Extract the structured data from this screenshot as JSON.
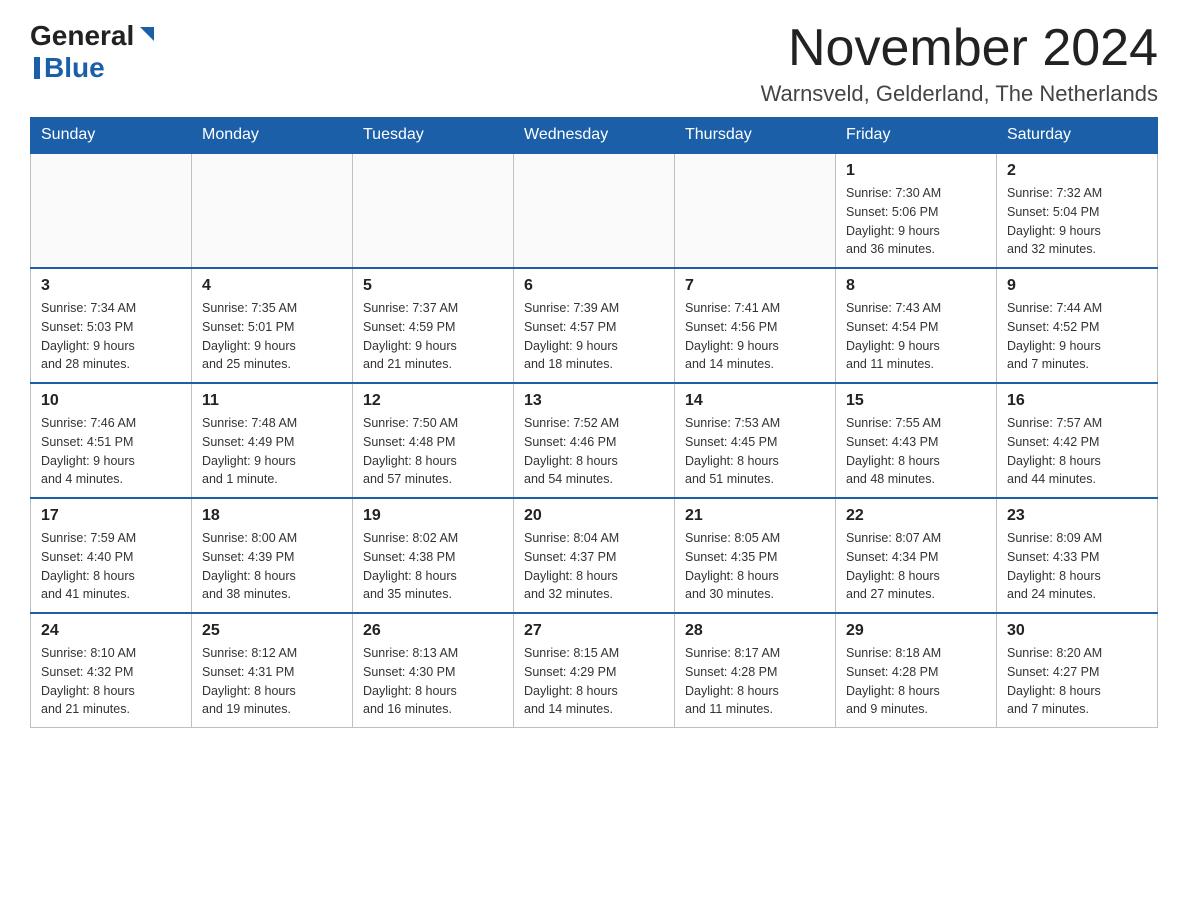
{
  "header": {
    "logo_general": "General",
    "logo_blue": "Blue",
    "month_title": "November 2024",
    "location": "Warnsveld, Gelderland, The Netherlands"
  },
  "weekdays": [
    "Sunday",
    "Monday",
    "Tuesday",
    "Wednesday",
    "Thursday",
    "Friday",
    "Saturday"
  ],
  "weeks": [
    {
      "days": [
        {
          "number": "",
          "info": ""
        },
        {
          "number": "",
          "info": ""
        },
        {
          "number": "",
          "info": ""
        },
        {
          "number": "",
          "info": ""
        },
        {
          "number": "",
          "info": ""
        },
        {
          "number": "1",
          "info": "Sunrise: 7:30 AM\nSunset: 5:06 PM\nDaylight: 9 hours\nand 36 minutes."
        },
        {
          "number": "2",
          "info": "Sunrise: 7:32 AM\nSunset: 5:04 PM\nDaylight: 9 hours\nand 32 minutes."
        }
      ]
    },
    {
      "days": [
        {
          "number": "3",
          "info": "Sunrise: 7:34 AM\nSunset: 5:03 PM\nDaylight: 9 hours\nand 28 minutes."
        },
        {
          "number": "4",
          "info": "Sunrise: 7:35 AM\nSunset: 5:01 PM\nDaylight: 9 hours\nand 25 minutes."
        },
        {
          "number": "5",
          "info": "Sunrise: 7:37 AM\nSunset: 4:59 PM\nDaylight: 9 hours\nand 21 minutes."
        },
        {
          "number": "6",
          "info": "Sunrise: 7:39 AM\nSunset: 4:57 PM\nDaylight: 9 hours\nand 18 minutes."
        },
        {
          "number": "7",
          "info": "Sunrise: 7:41 AM\nSunset: 4:56 PM\nDaylight: 9 hours\nand 14 minutes."
        },
        {
          "number": "8",
          "info": "Sunrise: 7:43 AM\nSunset: 4:54 PM\nDaylight: 9 hours\nand 11 minutes."
        },
        {
          "number": "9",
          "info": "Sunrise: 7:44 AM\nSunset: 4:52 PM\nDaylight: 9 hours\nand 7 minutes."
        }
      ]
    },
    {
      "days": [
        {
          "number": "10",
          "info": "Sunrise: 7:46 AM\nSunset: 4:51 PM\nDaylight: 9 hours\nand 4 minutes."
        },
        {
          "number": "11",
          "info": "Sunrise: 7:48 AM\nSunset: 4:49 PM\nDaylight: 9 hours\nand 1 minute."
        },
        {
          "number": "12",
          "info": "Sunrise: 7:50 AM\nSunset: 4:48 PM\nDaylight: 8 hours\nand 57 minutes."
        },
        {
          "number": "13",
          "info": "Sunrise: 7:52 AM\nSunset: 4:46 PM\nDaylight: 8 hours\nand 54 minutes."
        },
        {
          "number": "14",
          "info": "Sunrise: 7:53 AM\nSunset: 4:45 PM\nDaylight: 8 hours\nand 51 minutes."
        },
        {
          "number": "15",
          "info": "Sunrise: 7:55 AM\nSunset: 4:43 PM\nDaylight: 8 hours\nand 48 minutes."
        },
        {
          "number": "16",
          "info": "Sunrise: 7:57 AM\nSunset: 4:42 PM\nDaylight: 8 hours\nand 44 minutes."
        }
      ]
    },
    {
      "days": [
        {
          "number": "17",
          "info": "Sunrise: 7:59 AM\nSunset: 4:40 PM\nDaylight: 8 hours\nand 41 minutes."
        },
        {
          "number": "18",
          "info": "Sunrise: 8:00 AM\nSunset: 4:39 PM\nDaylight: 8 hours\nand 38 minutes."
        },
        {
          "number": "19",
          "info": "Sunrise: 8:02 AM\nSunset: 4:38 PM\nDaylight: 8 hours\nand 35 minutes."
        },
        {
          "number": "20",
          "info": "Sunrise: 8:04 AM\nSunset: 4:37 PM\nDaylight: 8 hours\nand 32 minutes."
        },
        {
          "number": "21",
          "info": "Sunrise: 8:05 AM\nSunset: 4:35 PM\nDaylight: 8 hours\nand 30 minutes."
        },
        {
          "number": "22",
          "info": "Sunrise: 8:07 AM\nSunset: 4:34 PM\nDaylight: 8 hours\nand 27 minutes."
        },
        {
          "number": "23",
          "info": "Sunrise: 8:09 AM\nSunset: 4:33 PM\nDaylight: 8 hours\nand 24 minutes."
        }
      ]
    },
    {
      "days": [
        {
          "number": "24",
          "info": "Sunrise: 8:10 AM\nSunset: 4:32 PM\nDaylight: 8 hours\nand 21 minutes."
        },
        {
          "number": "25",
          "info": "Sunrise: 8:12 AM\nSunset: 4:31 PM\nDaylight: 8 hours\nand 19 minutes."
        },
        {
          "number": "26",
          "info": "Sunrise: 8:13 AM\nSunset: 4:30 PM\nDaylight: 8 hours\nand 16 minutes."
        },
        {
          "number": "27",
          "info": "Sunrise: 8:15 AM\nSunset: 4:29 PM\nDaylight: 8 hours\nand 14 minutes."
        },
        {
          "number": "28",
          "info": "Sunrise: 8:17 AM\nSunset: 4:28 PM\nDaylight: 8 hours\nand 11 minutes."
        },
        {
          "number": "29",
          "info": "Sunrise: 8:18 AM\nSunset: 4:28 PM\nDaylight: 8 hours\nand 9 minutes."
        },
        {
          "number": "30",
          "info": "Sunrise: 8:20 AM\nSunset: 4:27 PM\nDaylight: 8 hours\nand 7 minutes."
        }
      ]
    }
  ]
}
